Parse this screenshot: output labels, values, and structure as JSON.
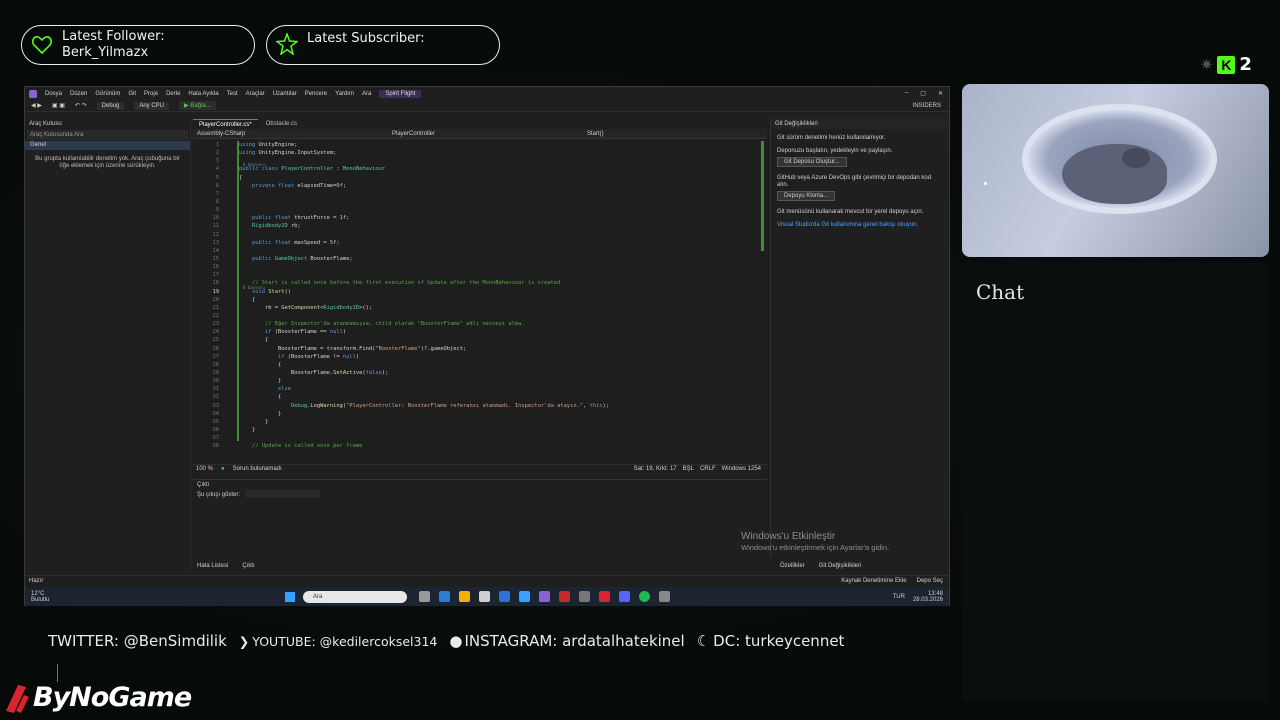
{
  "alerts": {
    "follower_label": "Latest Follower:",
    "follower_name": "Berk_Yilmazx",
    "subscriber_label": "Latest Subscriber:",
    "subscriber_name": ""
  },
  "kick": {
    "count": "2",
    "logo_letter": "K"
  },
  "chat": {
    "title": "Chat"
  },
  "vs": {
    "menu": [
      "Dosya",
      "Düzen",
      "Görünüm",
      "Git",
      "Proje",
      "Derle",
      "Hata Ayıkla",
      "Test",
      "Araçlar",
      "Uzantılar",
      "Pencere",
      "Yardım",
      "Ara"
    ],
    "solution_name": "Spirit Flight",
    "toolbar": {
      "config": "Debug",
      "platform": "Any CPU",
      "run": "Bağla...",
      "insiders": "INSIDERS"
    },
    "toolbox": {
      "title": "Araç Kutusu",
      "search": "Araç Kutusunda Ara",
      "group": "Genel",
      "message": "Bu grupta kullanılabilir denetim yok. Araç çubuğuna bir öğe eklemek için üzerine sürükleyin."
    },
    "tabs": [
      "PlayerController.cs*",
      "Obstacle.cs"
    ],
    "nav": {
      "project": "Assembly-CSharp",
      "class": "PlayerController",
      "member": "Start()"
    },
    "code": [
      {
        "n": "1",
        "h": "",
        "t": [
          [
            "kw",
            "using "
          ],
          [
            "tx",
            "UnityEngine;"
          ]
        ]
      },
      {
        "n": "2",
        "h": "",
        "t": [
          [
            "kw",
            "using "
          ],
          [
            "tx",
            "UnityEngine.InputSystem;"
          ]
        ]
      },
      {
        "n": "3",
        "h": "",
        "t": []
      },
      {
        "n": "4",
        "h": "0 başvuru",
        "t": [
          [
            "kw",
            "public class "
          ],
          [
            "ty",
            "PlayerController"
          ],
          [
            "tx",
            " : "
          ],
          [
            "ty",
            "MonoBehaviour"
          ]
        ]
      },
      {
        "n": "5",
        "h": "",
        "t": [
          [
            "tx",
            "{"
          ]
        ]
      },
      {
        "n": "6",
        "h": "",
        "t": [
          [
            "tx",
            "    "
          ],
          [
            "kw",
            "private float "
          ],
          [
            "tx",
            "elapsedTime="
          ],
          [
            "nm",
            "0f"
          ],
          [
            "tx",
            ";"
          ]
        ]
      },
      {
        "n": "7",
        "h": "",
        "t": []
      },
      {
        "n": "8",
        "h": "",
        "t": []
      },
      {
        "n": "9",
        "h": "",
        "t": []
      },
      {
        "n": "10",
        "h": "",
        "t": [
          [
            "tx",
            "    "
          ],
          [
            "kw",
            "public float "
          ],
          [
            "tx",
            "thrustForce = "
          ],
          [
            "nm",
            "1f"
          ],
          [
            "tx",
            ";"
          ]
        ]
      },
      {
        "n": "11",
        "h": "",
        "t": [
          [
            "tx",
            "    "
          ],
          [
            "ty",
            "Rigidbody2D "
          ],
          [
            "tx",
            "rb;"
          ]
        ]
      },
      {
        "n": "12",
        "h": "",
        "t": []
      },
      {
        "n": "13",
        "h": "",
        "t": [
          [
            "tx",
            "    "
          ],
          [
            "kw",
            "public float "
          ],
          [
            "tx",
            "maxSpeed = "
          ],
          [
            "nm",
            "5f"
          ],
          [
            "tx",
            ";"
          ]
        ]
      },
      {
        "n": "14",
        "h": "",
        "t": []
      },
      {
        "n": "15",
        "h": "",
        "t": [
          [
            "tx",
            "    "
          ],
          [
            "kw",
            "public "
          ],
          [
            "ty",
            "GameObject "
          ],
          [
            "tx",
            "BoosterFlame;"
          ]
        ]
      },
      {
        "n": "16",
        "h": "",
        "t": []
      },
      {
        "n": "17",
        "h": "",
        "t": []
      },
      {
        "n": "18",
        "h": "",
        "t": [
          [
            "cm",
            "    // Start is called once before the first execution of Update after the MonoBehaviour is created"
          ]
        ]
      },
      {
        "n": "19",
        "h": "0 başvuru",
        "t": [
          [
            "tx",
            "    "
          ],
          [
            "kw",
            "void "
          ],
          [
            "fn",
            "Start"
          ],
          [
            "tx",
            "()"
          ]
        ]
      },
      {
        "n": "20",
        "h": "",
        "t": [
          [
            "tx",
            "    {"
          ]
        ]
      },
      {
        "n": "21",
        "h": "",
        "t": [
          [
            "tx",
            "        rb = "
          ],
          [
            "fn",
            "GetComponent"
          ],
          [
            "tx",
            "<"
          ],
          [
            "ty",
            "Rigidbody2D"
          ],
          [
            "tx",
            ">();"
          ]
        ]
      },
      {
        "n": "22",
        "h": "",
        "t": []
      },
      {
        "n": "23",
        "h": "",
        "t": [
          [
            "cm",
            "        // Eğer Inspector'da atanmamışsa, child olarak \"BoosterFlame\" adlı nesneyi alma."
          ]
        ]
      },
      {
        "n": "24",
        "h": "",
        "t": [
          [
            "tx",
            "        "
          ],
          [
            "kw",
            "if "
          ],
          [
            "tx",
            "(BoosterFlame == "
          ],
          [
            "kw",
            "null"
          ],
          [
            "tx",
            ")"
          ]
        ]
      },
      {
        "n": "25",
        "h": "",
        "t": [
          [
            "tx",
            "        {"
          ]
        ]
      },
      {
        "n": "26",
        "h": "",
        "t": [
          [
            "tx",
            "            BoosterFlame = transform."
          ],
          [
            "fn",
            "Find"
          ],
          [
            "tx",
            "("
          ],
          [
            "st",
            "\"BoosterFlame\""
          ],
          [
            "tx",
            ")?.gameObject;"
          ]
        ]
      },
      {
        "n": "27",
        "h": "",
        "t": [
          [
            "tx",
            "            "
          ],
          [
            "kw",
            "if "
          ],
          [
            "tx",
            "(BoosterFlame != "
          ],
          [
            "kw",
            "null"
          ],
          [
            "tx",
            ")"
          ]
        ]
      },
      {
        "n": "28",
        "h": "",
        "t": [
          [
            "tx",
            "            {"
          ]
        ]
      },
      {
        "n": "29",
        "h": "",
        "t": [
          [
            "tx",
            "                BoosterFlame."
          ],
          [
            "fn",
            "SetActive"
          ],
          [
            "tx",
            "("
          ],
          [
            "kw",
            "false"
          ],
          [
            "tx",
            ");"
          ]
        ]
      },
      {
        "n": "30",
        "h": "",
        "t": [
          [
            "tx",
            "            }"
          ]
        ]
      },
      {
        "n": "31",
        "h": "",
        "t": [
          [
            "tx",
            "            "
          ],
          [
            "kw",
            "else"
          ]
        ]
      },
      {
        "n": "32",
        "h": "",
        "t": [
          [
            "tx",
            "            {"
          ]
        ]
      },
      {
        "n": "33",
        "h": "",
        "t": [
          [
            "tx",
            "                "
          ],
          [
            "ty",
            "Debug"
          ],
          [
            "tx",
            "."
          ],
          [
            "fn",
            "LogWarning"
          ],
          [
            "tx",
            "("
          ],
          [
            "st",
            "\"PlayerController: BoosterFlame referansı atanmadı. Inspector'da atayın.\""
          ],
          [
            "tx",
            ", "
          ],
          [
            "kw",
            "this"
          ],
          [
            "tx",
            ");"
          ]
        ]
      },
      {
        "n": "34",
        "h": "",
        "t": [
          [
            "tx",
            "            }"
          ]
        ]
      },
      {
        "n": "35",
        "h": "",
        "t": [
          [
            "tx",
            "        }"
          ]
        ]
      },
      {
        "n": "36",
        "h": "",
        "t": [
          [
            "tx",
            "    }"
          ]
        ]
      },
      {
        "n": "37",
        "h": "",
        "t": []
      },
      {
        "n": "38",
        "h": "",
        "t": [
          [
            "cm",
            "    // Update is called once per frame"
          ]
        ]
      }
    ],
    "current_line": "19",
    "editor_status": {
      "zoom": "100 %",
      "issues": "Sorun bulunamadı",
      "position": "Sat: 19, Krkt: 17",
      "ws": "BŞL",
      "eol": "CRLF",
      "encoding": "Windows 1254"
    },
    "output": {
      "title": "Çıktı",
      "from_label": "Şu çıkışı göster:"
    },
    "bottom_tabs": [
      "Hata Listesi",
      "Çıktı"
    ],
    "git": {
      "title": "Git Değişiklikleri",
      "p1": "Git sürüm denetimi henüz kullanılamıyor.",
      "p2": "Deponuzu başlatın, yedekleyin ve paylaşın.",
      "btn1": "Git Deposu Oluştur...",
      "p3": "GitHub veya Azure DevOps gibi çevrimiçi bir depodan kod alın.",
      "btn2": "Depoyu Klonla...",
      "p4": "Git menüsünü kullanarak mevcut bir yerel depoyu açın.",
      "link": "Visual Studio'da Git kullanımına genel bakışı okuyun.",
      "watermark_title": "Windows'u Etkinleştir",
      "watermark_sub": "Windows'u etkinleştirmek için Ayarlar'a gidin.",
      "tabs": [
        "Özellikler",
        "Git Değişiklikleri"
      ]
    },
    "status_bar": {
      "left": "Hazır",
      "source": "Kaynak Denetimine Ekle",
      "repo": "Depo Seç"
    },
    "taskbar": {
      "temp": "12°C",
      "weather": "Bulutlu",
      "search": "Ara",
      "lang": "TUR",
      "time": "13:48",
      "date": "28.03.2026"
    }
  },
  "socials": {
    "twitter": "TWITTER: @BenSimdilik",
    "youtube": "YOUTUBE: @kedilercoksel314",
    "instagram": "INSTAGRAM: ardatalhatekinel",
    "dc": "DC: turkeycennet"
  },
  "brand": {
    "name": "ByNoGame"
  },
  "colors": {
    "accent": "#53fc18",
    "vs_purple": "#8a63d2"
  }
}
